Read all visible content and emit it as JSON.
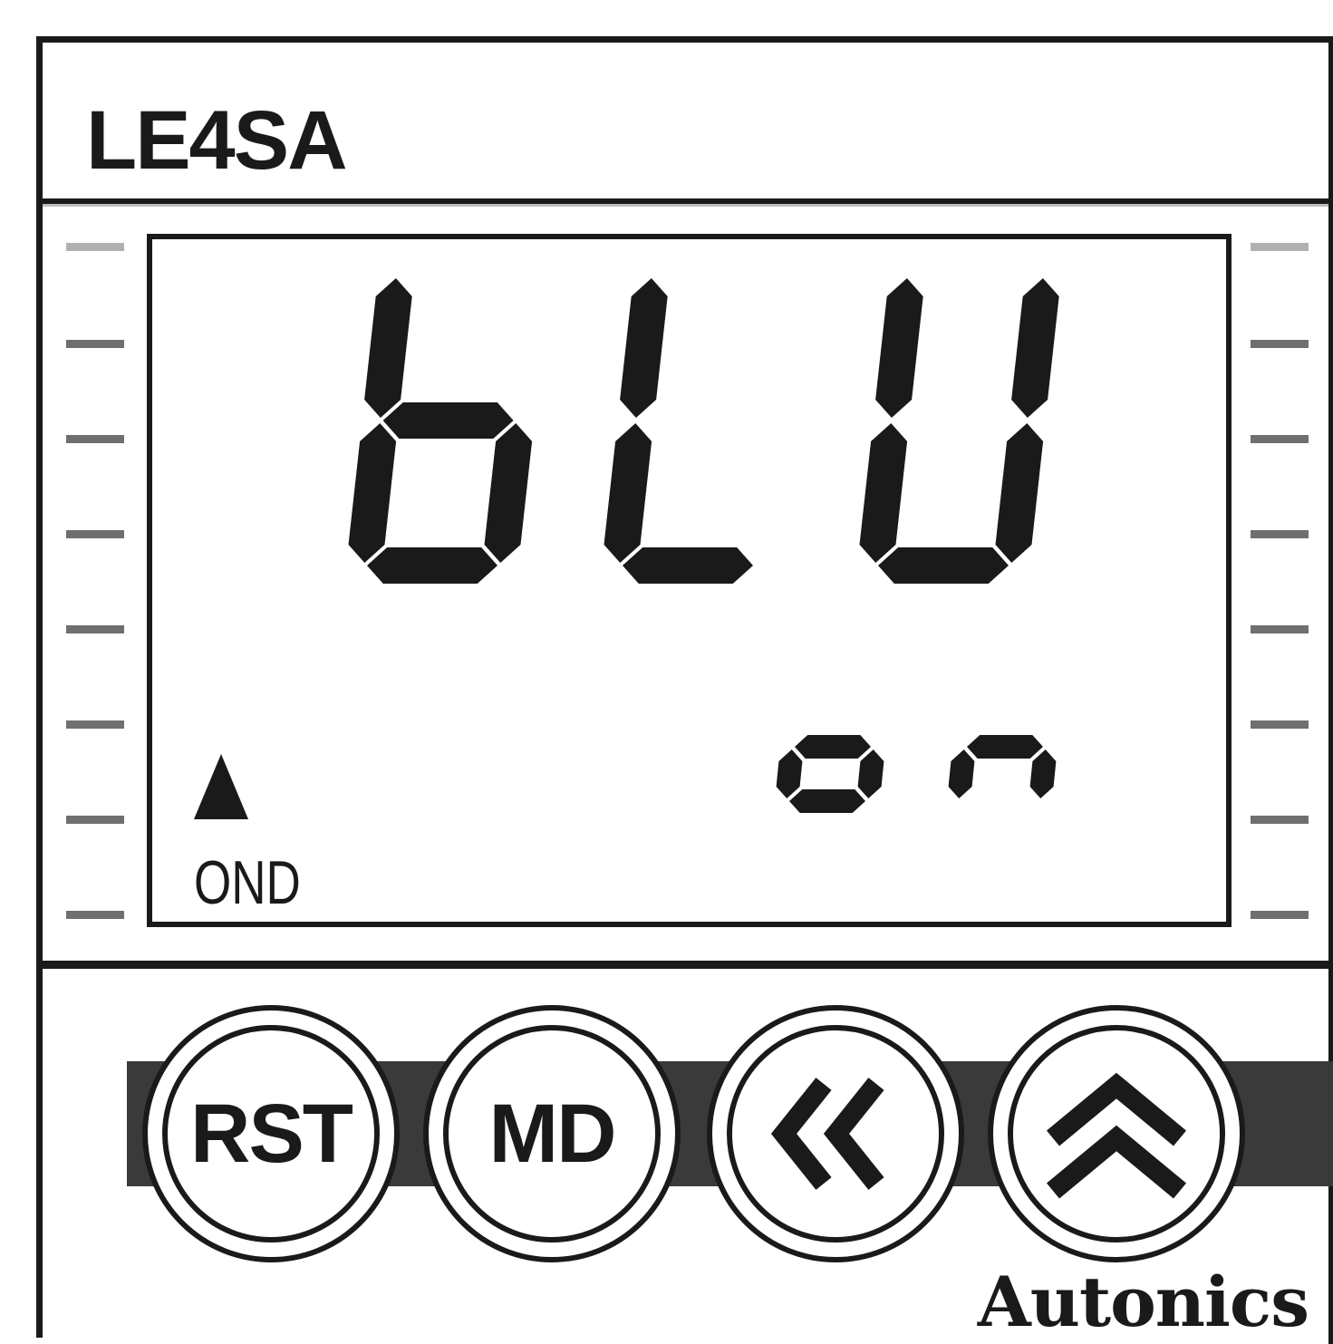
{
  "device": {
    "model": "LE4SA",
    "brand": "Autonics"
  },
  "display": {
    "main_readout": "bLU",
    "sub_readout": "on",
    "indicator": {
      "symbol": "▲",
      "label": "OND"
    },
    "segment_color": "#1a1a1a"
  },
  "buttons": {
    "reset": {
      "label": "RST"
    },
    "mode": {
      "label": "MD"
    },
    "shift": {
      "icon": "double-chevron-left-icon"
    },
    "up": {
      "icon": "double-chevron-up-icon"
    }
  },
  "colors": {
    "ink": "#1a1a1a",
    "band": "#3a3a3a",
    "background": "#ffffff"
  }
}
